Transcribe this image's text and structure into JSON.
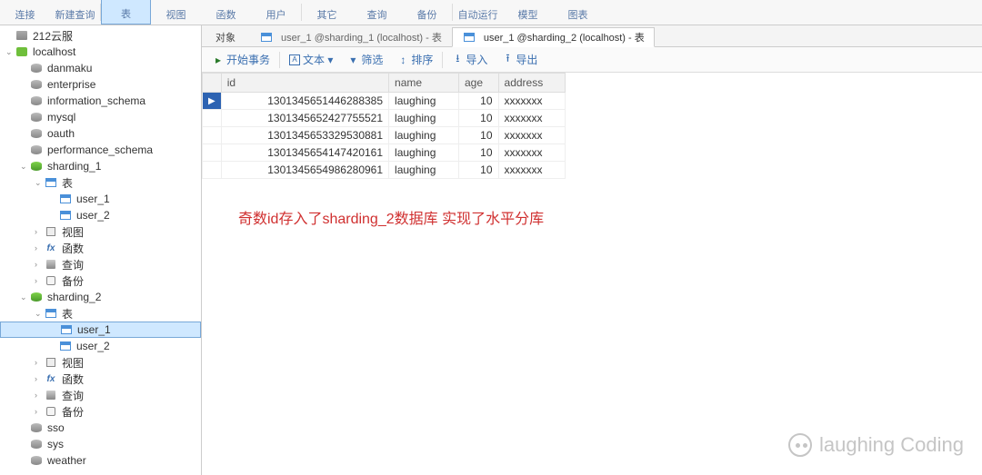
{
  "toolbar": {
    "items": [
      {
        "label": "连接"
      },
      {
        "label": "新建查询"
      },
      {
        "label": "表",
        "active": true
      },
      {
        "label": "视图"
      },
      {
        "label": "函数"
      },
      {
        "label": "用户"
      },
      {
        "label": "其它"
      },
      {
        "label": "查询"
      },
      {
        "label": "备份"
      },
      {
        "label": "自动运行"
      },
      {
        "label": "模型"
      },
      {
        "label": "图表"
      }
    ]
  },
  "sidebar": {
    "tree": [
      {
        "label": "212云服",
        "depth": 0,
        "kind": "server"
      },
      {
        "label": "localhost",
        "depth": 0,
        "kind": "conn",
        "caret": "open"
      },
      {
        "label": "danmaku",
        "depth": 1,
        "kind": "db"
      },
      {
        "label": "enterprise",
        "depth": 1,
        "kind": "db"
      },
      {
        "label": "information_schema",
        "depth": 1,
        "kind": "db"
      },
      {
        "label": "mysql",
        "depth": 1,
        "kind": "db"
      },
      {
        "label": "oauth",
        "depth": 1,
        "kind": "db"
      },
      {
        "label": "performance_schema",
        "depth": 1,
        "kind": "db"
      },
      {
        "label": "sharding_1",
        "depth": 1,
        "kind": "dbopen",
        "caret": "open"
      },
      {
        "label": "表",
        "depth": 2,
        "kind": "table",
        "caret": "open"
      },
      {
        "label": "user_1",
        "depth": 3,
        "kind": "table"
      },
      {
        "label": "user_2",
        "depth": 3,
        "kind": "table"
      },
      {
        "label": "视图",
        "depth": 2,
        "kind": "view",
        "caret": "closed"
      },
      {
        "label": "函数",
        "depth": 2,
        "kind": "fx",
        "caret": "closed"
      },
      {
        "label": "查询",
        "depth": 2,
        "kind": "query",
        "caret": "closed"
      },
      {
        "label": "备份",
        "depth": 2,
        "kind": "backup",
        "caret": "closed"
      },
      {
        "label": "sharding_2",
        "depth": 1,
        "kind": "dbopen",
        "caret": "open"
      },
      {
        "label": "表",
        "depth": 2,
        "kind": "table",
        "caret": "open"
      },
      {
        "label": "user_1",
        "depth": 3,
        "kind": "table",
        "selected": true
      },
      {
        "label": "user_2",
        "depth": 3,
        "kind": "table"
      },
      {
        "label": "视图",
        "depth": 2,
        "kind": "view",
        "caret": "closed"
      },
      {
        "label": "函数",
        "depth": 2,
        "kind": "fx",
        "caret": "closed"
      },
      {
        "label": "查询",
        "depth": 2,
        "kind": "query",
        "caret": "closed"
      },
      {
        "label": "备份",
        "depth": 2,
        "kind": "backup",
        "caret": "closed"
      },
      {
        "label": "sso",
        "depth": 1,
        "kind": "db"
      },
      {
        "label": "sys",
        "depth": 1,
        "kind": "db"
      },
      {
        "label": "weather",
        "depth": 1,
        "kind": "db"
      }
    ]
  },
  "tabs": {
    "obj": "对象",
    "items": [
      {
        "label": "user_1 @sharding_1 (localhost) - 表"
      },
      {
        "label": "user_1 @sharding_2 (localhost) - 表",
        "active": true
      }
    ]
  },
  "subtoolbar": {
    "start_tx": "开始事务",
    "text": "文本 ▾",
    "filter": "筛选",
    "sort": "排序",
    "import": "导入",
    "export": "导出"
  },
  "grid": {
    "columns": [
      "id",
      "name",
      "age",
      "address"
    ],
    "rows": [
      {
        "id": "1301345651446288385",
        "name": "laughing",
        "age": "10",
        "address": "xxxxxxx",
        "sel": true
      },
      {
        "id": "1301345652427755521",
        "name": "laughing",
        "age": "10",
        "address": "xxxxxxx"
      },
      {
        "id": "1301345653329530881",
        "name": "laughing",
        "age": "10",
        "address": "xxxxxxx"
      },
      {
        "id": "1301345654147420161",
        "name": "laughing",
        "age": "10",
        "address": "xxxxxxx"
      },
      {
        "id": "1301345654986280961",
        "name": "laughing",
        "age": "10",
        "address": "xxxxxxx"
      }
    ]
  },
  "annotation": "奇数id存入了sharding_2数据库 实现了水平分库",
  "watermark": "laughing Coding"
}
